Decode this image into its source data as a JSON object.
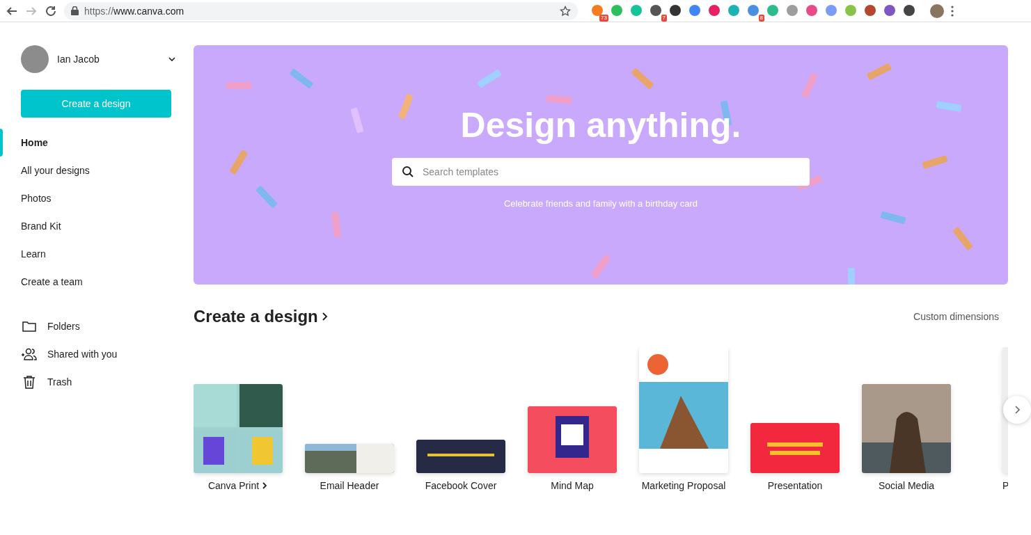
{
  "browser": {
    "url_scheme": "https://",
    "url_host": "www.canva.com",
    "extensions": [
      {
        "color": "#f47b20",
        "badge": "73"
      },
      {
        "color": "#2dbe60"
      },
      {
        "color": "#15c39a"
      },
      {
        "color": "#555555",
        "badge": "7"
      },
      {
        "color": "#333333"
      },
      {
        "color": "#4285f4"
      },
      {
        "color": "#e91e63"
      },
      {
        "color": "#1db3b3"
      },
      {
        "color": "#4a90e2",
        "badge": "8"
      },
      {
        "color": "#2bbc8a"
      },
      {
        "color": "#9e9e9e"
      },
      {
        "color": "#e84c88"
      },
      {
        "color": "#7b9cf5"
      },
      {
        "color": "#8bc34a"
      },
      {
        "color": "#b5462f"
      },
      {
        "color": "#7e57c2"
      },
      {
        "color": "#444444"
      }
    ]
  },
  "sidebar": {
    "user_name": "Ian Jacob",
    "create_button": "Create a design",
    "nav": [
      {
        "label": "Home",
        "selected": true
      },
      {
        "label": "All your designs",
        "selected": false
      },
      {
        "label": "Photos",
        "selected": false
      },
      {
        "label": "Brand Kit",
        "selected": false
      },
      {
        "label": "Learn",
        "selected": false
      },
      {
        "label": "Create a team",
        "selected": false
      }
    ],
    "links": [
      {
        "kind": "folder",
        "label": "Folders"
      },
      {
        "kind": "shared",
        "label": "Shared with you"
      },
      {
        "kind": "trash",
        "label": "Trash"
      }
    ]
  },
  "hero": {
    "title": "Design anything.",
    "search_placeholder": "Search templates",
    "suggestion": "Celebrate friends and family with a birthday card"
  },
  "designs": {
    "title": "Create a design",
    "custom_link": "Custom dimensions",
    "cards": [
      {
        "kind": "print",
        "label": "Canva Print",
        "arrow": true
      },
      {
        "kind": "email",
        "label": "Email Header",
        "arrow": false
      },
      {
        "kind": "facebook",
        "label": "Facebook Cover",
        "arrow": false
      },
      {
        "kind": "mindmap",
        "label": "Mind Map",
        "arrow": false
      },
      {
        "kind": "proposal",
        "label": "Marketing Proposal",
        "arrow": false
      },
      {
        "kind": "presentation",
        "label": "Presentation",
        "arrow": false
      },
      {
        "kind": "social",
        "label": "Social Media",
        "arrow": false
      },
      {
        "kind": "poster",
        "label": "P",
        "arrow": false
      }
    ]
  }
}
